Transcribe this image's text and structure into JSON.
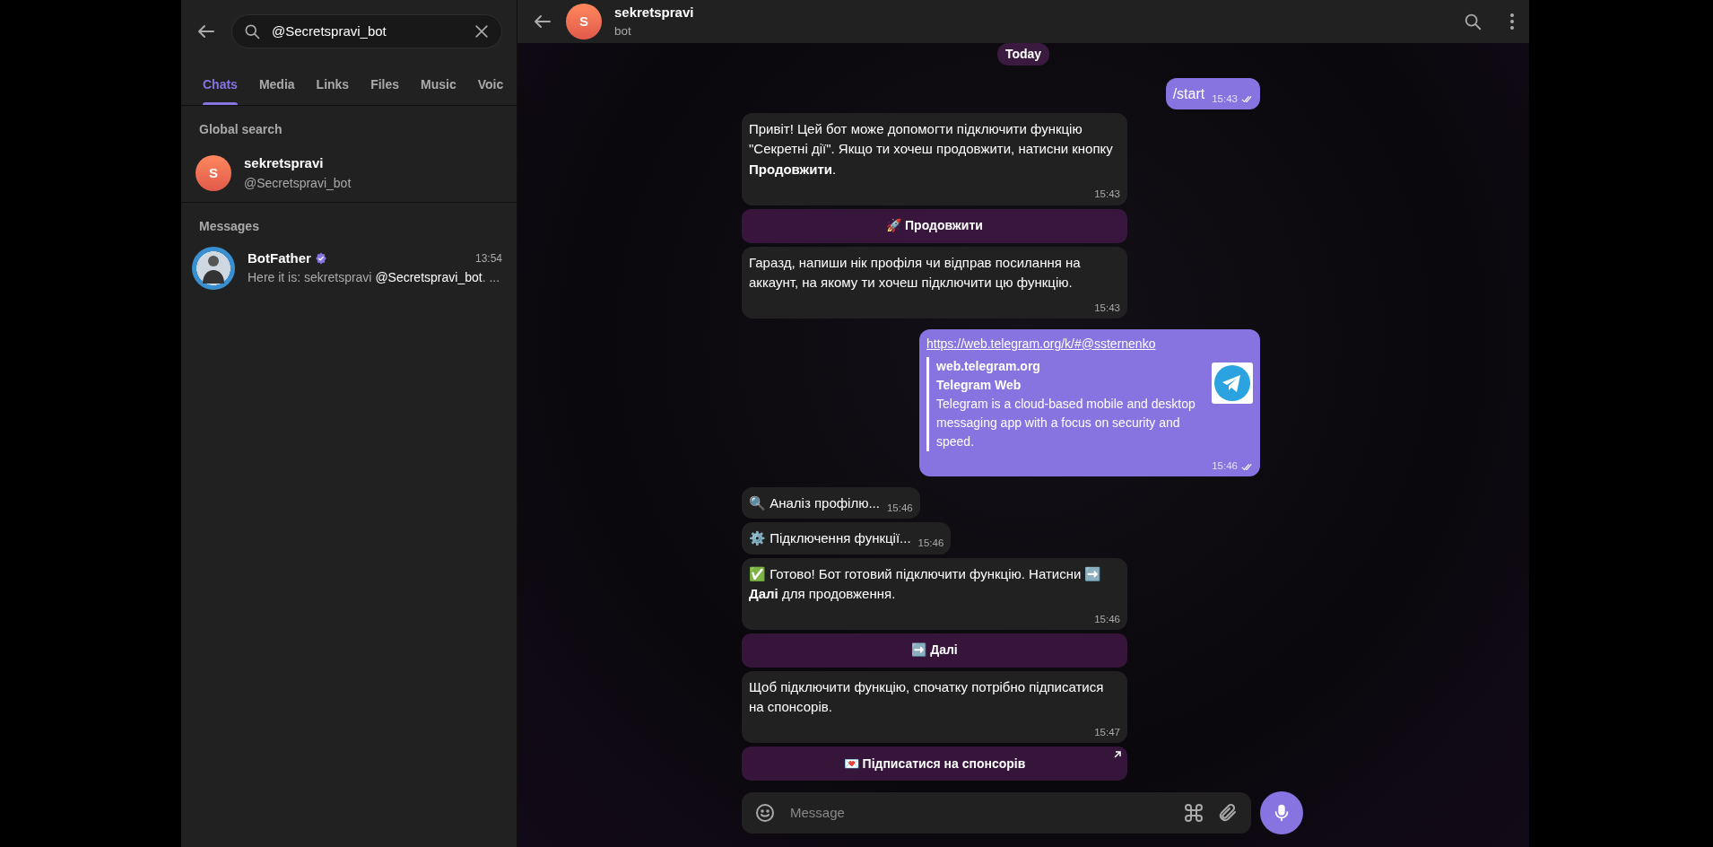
{
  "search": {
    "value": "@Secretspravi_bot"
  },
  "tabs": [
    {
      "label": "Chats",
      "selected": true
    },
    {
      "label": "Media",
      "selected": false
    },
    {
      "label": "Links",
      "selected": false
    },
    {
      "label": "Files",
      "selected": false
    },
    {
      "label": "Music",
      "selected": false
    },
    {
      "label": "Voic",
      "selected": false
    }
  ],
  "global_search": {
    "heading": "Global search",
    "results": [
      {
        "initial": "S",
        "name": "sekretspravi",
        "username": "@Secretspravi_bot"
      }
    ]
  },
  "messages_section": {
    "heading": "Messages",
    "results": [
      {
        "name": "BotFather",
        "verified": true,
        "time": "13:54",
        "preview": "Here it is: sekretspravi **@Secretspravi_bot**. ..."
      }
    ]
  },
  "chat_header": {
    "initial": "S",
    "title": "sekretspravi",
    "subtitle": "bot"
  },
  "date_label": "Today",
  "messages": [
    {
      "kind": "outgoing",
      "text": "/start",
      "time": "15:43",
      "read": true
    },
    {
      "kind": "incoming",
      "text": "Привіт! Цей бот може допомогти підключити функцію \"Секретні дії\". Якщо ти хочеш продовжити, натисни кнопку **Продовжити**.",
      "time": "15:43"
    },
    {
      "kind": "button",
      "label": "🚀 Продовжити",
      "external": false
    },
    {
      "kind": "incoming",
      "text": "Гаразд, напиши нік профіля чи відправ посилання на аккаунт, на якому ти хочеш підключити цю функцію.",
      "time": "15:43"
    },
    {
      "kind": "link",
      "url": "https://web.telegram.org/k/#@ssternenko",
      "site": "web.telegram.org",
      "title": "Telegram Web",
      "description": "Telegram is a cloud-based mobile and desktop messaging app with a focus on security and speed.",
      "time": "15:46",
      "read": true
    },
    {
      "kind": "incoming",
      "text": "🔍 Аналіз профілю...",
      "time": "15:46"
    },
    {
      "kind": "incoming",
      "text": "⚙️ Підключення функції...",
      "time": "15:46"
    },
    {
      "kind": "incoming",
      "text": "✅ Готово! Бот готовий підключити функцію. Натисни ➡️ **Далі** для продовження.",
      "time": "15:46"
    },
    {
      "kind": "button",
      "label": "➡️ Далі",
      "external": false
    },
    {
      "kind": "incoming",
      "text": "Щоб підключити функцію, спочатку потрібно підписатися на спонсорів.",
      "time": "15:47"
    },
    {
      "kind": "button",
      "label": "💌 Підписатися на спонсорів",
      "external": true
    }
  ],
  "composer": {
    "placeholder": "Message"
  }
}
